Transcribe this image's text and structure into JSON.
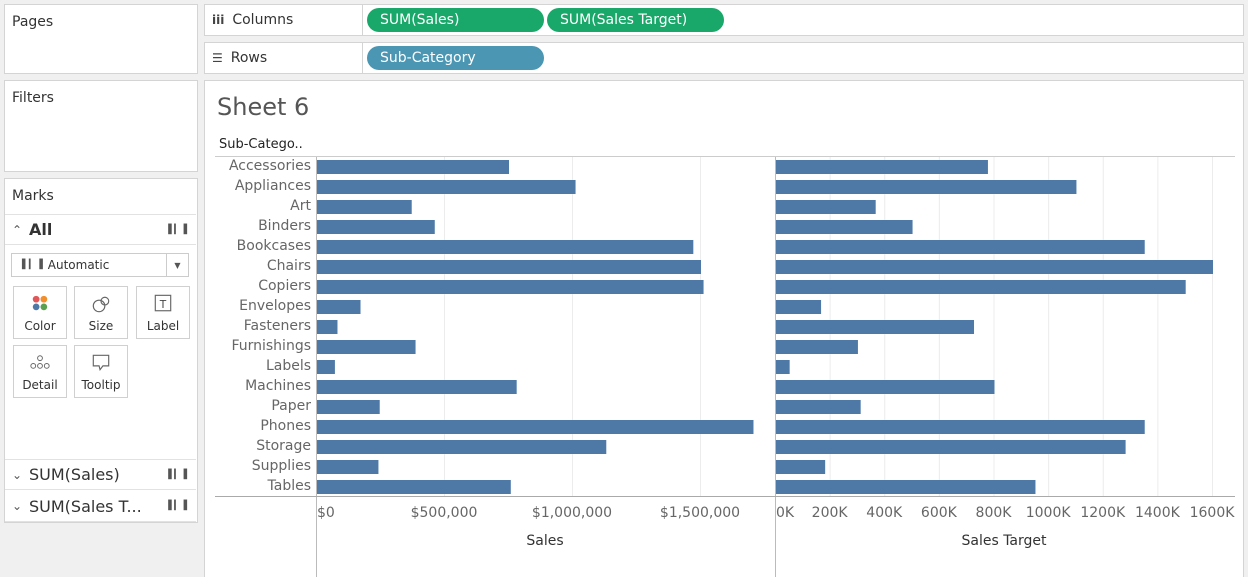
{
  "panels": {
    "pages": "Pages",
    "filters": "Filters",
    "marks": "Marks"
  },
  "shelves": {
    "columns": {
      "label": "Columns",
      "icon": "columns-icon",
      "pills": [
        "SUM(Sales)",
        "SUM(Sales Target)"
      ]
    },
    "rows": {
      "label": "Rows",
      "icon": "rows-icon",
      "pills": [
        "Sub-Category"
      ]
    }
  },
  "marks": {
    "all_label": "All",
    "mark_type": "Automatic",
    "buttons": [
      "Color",
      "Size",
      "Label",
      "Detail",
      "Tooltip"
    ],
    "measures": [
      "SUM(Sales)",
      "SUM(Sales T..."
    ]
  },
  "colors": {
    "bar": "#4e79a7",
    "pill_green": "#1aa86a",
    "pill_blue": "#4a96b3"
  },
  "sheet": {
    "title": "Sheet 6",
    "row_header": "Sub-Catego.."
  },
  "chart_data": [
    {
      "type": "bar",
      "orientation": "horizontal",
      "categories": [
        "Accessories",
        "Appliances",
        "Art",
        "Binders",
        "Bookcases",
        "Chairs",
        "Copiers",
        "Envelopes",
        "Fasteners",
        "Furnishings",
        "Labels",
        "Machines",
        "Paper",
        "Phones",
        "Storage",
        "Supplies",
        "Tables"
      ],
      "values": [
        750000,
        1010000,
        370000,
        460000,
        1470000,
        1500000,
        1510000,
        170000,
        80000,
        385000,
        70000,
        780000,
        245000,
        1705000,
        1130000,
        240000,
        757000
      ],
      "xlabel": "Sales",
      "ticks": [
        "$0",
        "$500,000",
        "$1,000,000",
        "$1,500,000"
      ],
      "tick_values": [
        0,
        500000,
        1000000,
        1500000
      ],
      "xlim": [
        0,
        1750000
      ]
    },
    {
      "type": "bar",
      "orientation": "horizontal",
      "categories": [
        "Accessories",
        "Appliances",
        "Art",
        "Binders",
        "Bookcases",
        "Chairs",
        "Copiers",
        "Envelopes",
        "Fasteners",
        "Furnishings",
        "Labels",
        "Machines",
        "Paper",
        "Phones",
        "Storage",
        "Supplies",
        "Tables"
      ],
      "values": [
        776000,
        1100000,
        365000,
        500000,
        1350000,
        1600000,
        1500000,
        165000,
        725000,
        300000,
        50000,
        800000,
        310000,
        1350000,
        1280000,
        180000,
        950000
      ],
      "xlabel": "Sales Target",
      "ticks": [
        "0K",
        "200K",
        "400K",
        "600K",
        "800K",
        "1000K",
        "1200K",
        "1400K",
        "1600K"
      ],
      "tick_values": [
        0,
        200000,
        400000,
        600000,
        800000,
        1000000,
        1200000,
        1400000,
        1600000
      ],
      "xlim": [
        0,
        1600000
      ]
    }
  ]
}
